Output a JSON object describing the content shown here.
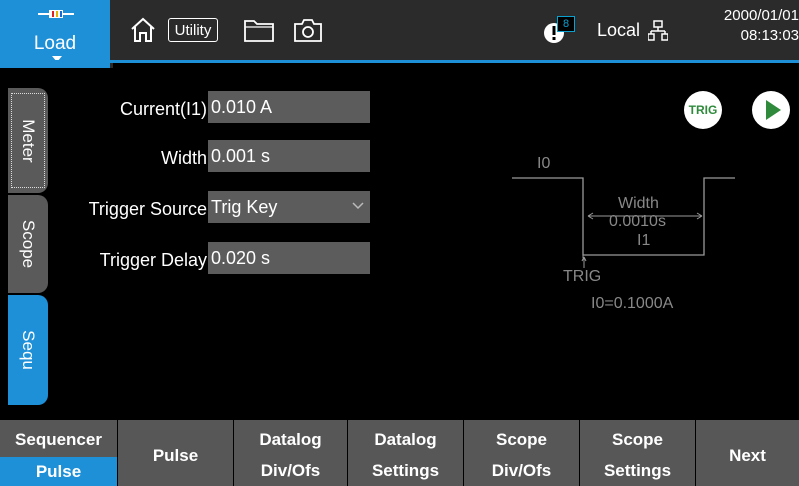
{
  "topbar": {
    "load_label": "Load",
    "utility_label": "Utility",
    "notification_count": "8",
    "local_label": "Local",
    "date": "2000/01/01",
    "time": "08:13:03"
  },
  "side_tabs": [
    {
      "label": "Meter"
    },
    {
      "label": "Scope"
    },
    {
      "label": "Sequ"
    }
  ],
  "form": {
    "current_label": "Current(I1)",
    "current_value": "0.010 A",
    "width_label": "Width",
    "width_value": "0.001 s",
    "trigger_source_label": "Trigger Source",
    "trigger_source_value": "Trig Key",
    "trigger_delay_label": "Trigger Delay",
    "trigger_delay_value": "0.020 s"
  },
  "controls": {
    "trig_label": "TRIG"
  },
  "waveform": {
    "i0_label": "I0",
    "width_label": "Width",
    "width_value": "0.0010s",
    "i1_label": "I1",
    "trig_label": "TRIG",
    "i0_value": "I0=0.1000A"
  },
  "softkeys": {
    "sequencer_top": "Sequencer",
    "sequencer_selected": "Pulse",
    "pulse": "Pulse",
    "datalog_divofs_top": "Datalog",
    "datalog_divofs_bottom": "Div/Ofs",
    "datalog_settings_top": "Datalog",
    "datalog_settings_bottom": "Settings",
    "scope_divofs_top": "Scope",
    "scope_divofs_bottom": "Div/Ofs",
    "scope_settings_top": "Scope",
    "scope_settings_bottom": "Settings",
    "next": "Next"
  },
  "colors": {
    "accent": "#1e90d8",
    "panel": "#575757",
    "field": "#5c5c5c",
    "trig_green": "#2f8a3c",
    "badge": "#0aa0d0"
  }
}
